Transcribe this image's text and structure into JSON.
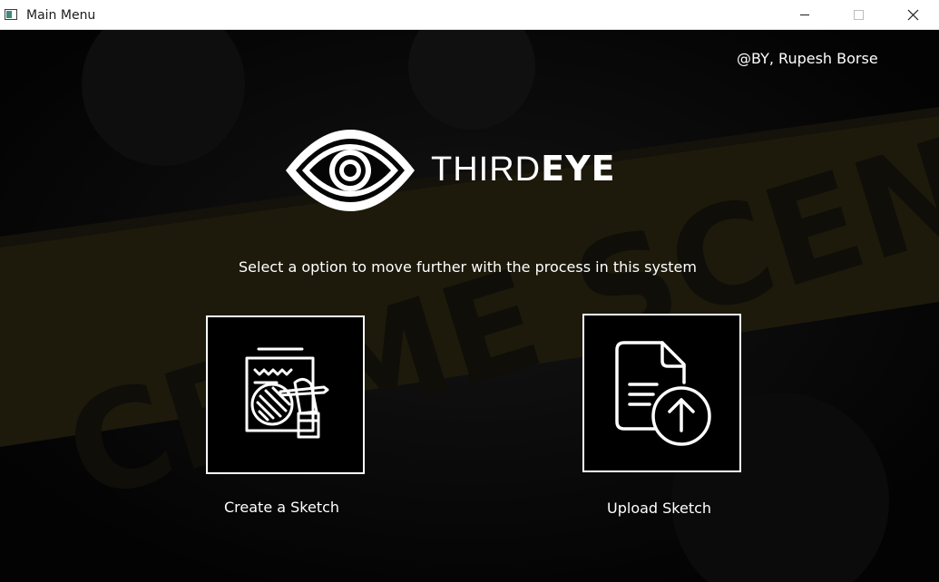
{
  "window": {
    "title": "Main Menu",
    "controls": [
      "minimize-icon",
      "maximize-icon",
      "close-icon"
    ]
  },
  "header": {
    "credit": "@BY, Rupesh Borse"
  },
  "brand": {
    "light": "THIRD",
    "bold": "EYE",
    "logo_icon": "eye-logo-icon"
  },
  "background": {
    "tape_text": "CRIME SCENE DO NOT"
  },
  "main": {
    "prompt": "Select a option to move further with the process in this system",
    "options": [
      {
        "label": "Create a Sketch",
        "icon": "sketch-drawing-icon"
      },
      {
        "label": "Upload Sketch",
        "icon": "document-upload-icon"
      }
    ]
  },
  "colors": {
    "background": "#050505",
    "tape": "#1d1a0c",
    "foreground": "#ffffff",
    "titlebar": "#ffffff"
  }
}
